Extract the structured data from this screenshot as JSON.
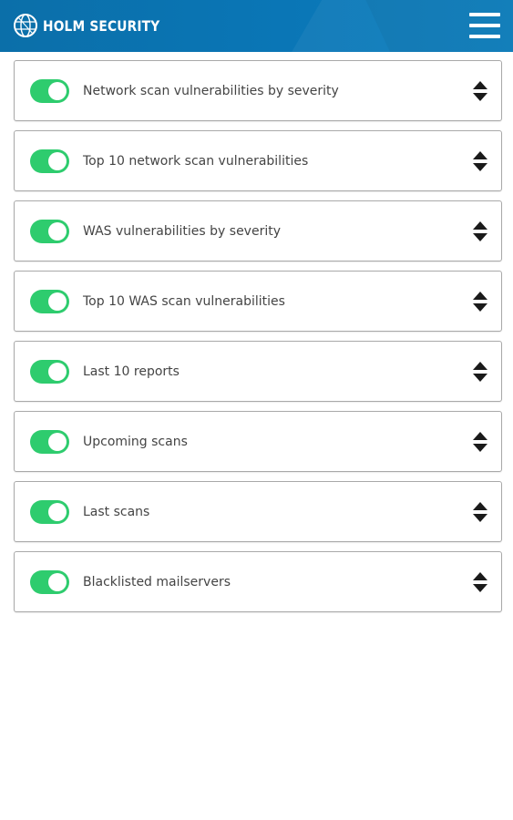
{
  "header": {
    "logo_text": "HOLM SECURITY",
    "logo_icon": "globe-icon",
    "menu_icon": "hamburger-menu-icon"
  },
  "colors": {
    "header_blue": "#0a76b6",
    "toggle_on": "#2ecc6e",
    "card_border": "#a9a9a9",
    "label_text": "#444444"
  },
  "widgets": [
    {
      "label": "Network scan vulnerabilities by severity",
      "enabled": true
    },
    {
      "label": "Top 10 network scan vulnerabilities",
      "enabled": true
    },
    {
      "label": "WAS vulnerabilities by severity",
      "enabled": true
    },
    {
      "label": "Top 10 WAS scan vulnerabilities",
      "enabled": true
    },
    {
      "label": "Last 10 reports",
      "enabled": true
    },
    {
      "label": "Upcoming scans",
      "enabled": true
    },
    {
      "label": "Last scans",
      "enabled": true
    },
    {
      "label": "Blacklisted mailservers",
      "enabled": true
    }
  ]
}
